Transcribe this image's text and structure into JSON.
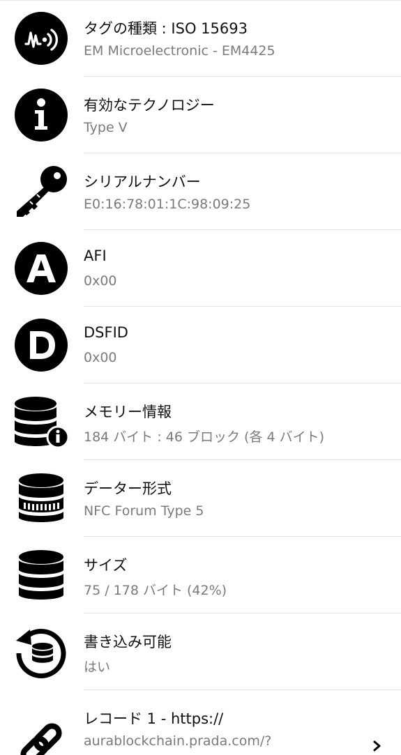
{
  "rows": [
    {
      "title": "タグの種類 : ISO 15693",
      "value": "EM Microelectronic - EM4425",
      "icon": "nfc-tag-icon"
    },
    {
      "title": "有効なテクノロジー",
      "value": "Type V",
      "icon": "info-icon"
    },
    {
      "title": "シリアルナンバー",
      "value": "E0:16:78:01:1C:98:09:25",
      "icon": "key-icon"
    },
    {
      "title": "AFI",
      "value": "0x00",
      "icon": "letter-a-icon"
    },
    {
      "title": "DSFID",
      "value": "0x00",
      "icon": "letter-d-icon"
    },
    {
      "title": "メモリー情報",
      "value": "184 バイト : 46 ブロック (各 4 バイト)",
      "icon": "database-info-icon"
    },
    {
      "title": "データー形式",
      "value": "NFC Forum Type 5",
      "icon": "database-format-icon"
    },
    {
      "title": "サイズ",
      "value": "75 / 178 バイト (42%)",
      "icon": "database-icon"
    },
    {
      "title": "書き込み可能",
      "value": "はい",
      "icon": "database-refresh-icon"
    },
    {
      "title": "レコード 1 - https://",
      "value": "aurablockchain.prada.com/?",
      "icon": "link-icon"
    }
  ]
}
